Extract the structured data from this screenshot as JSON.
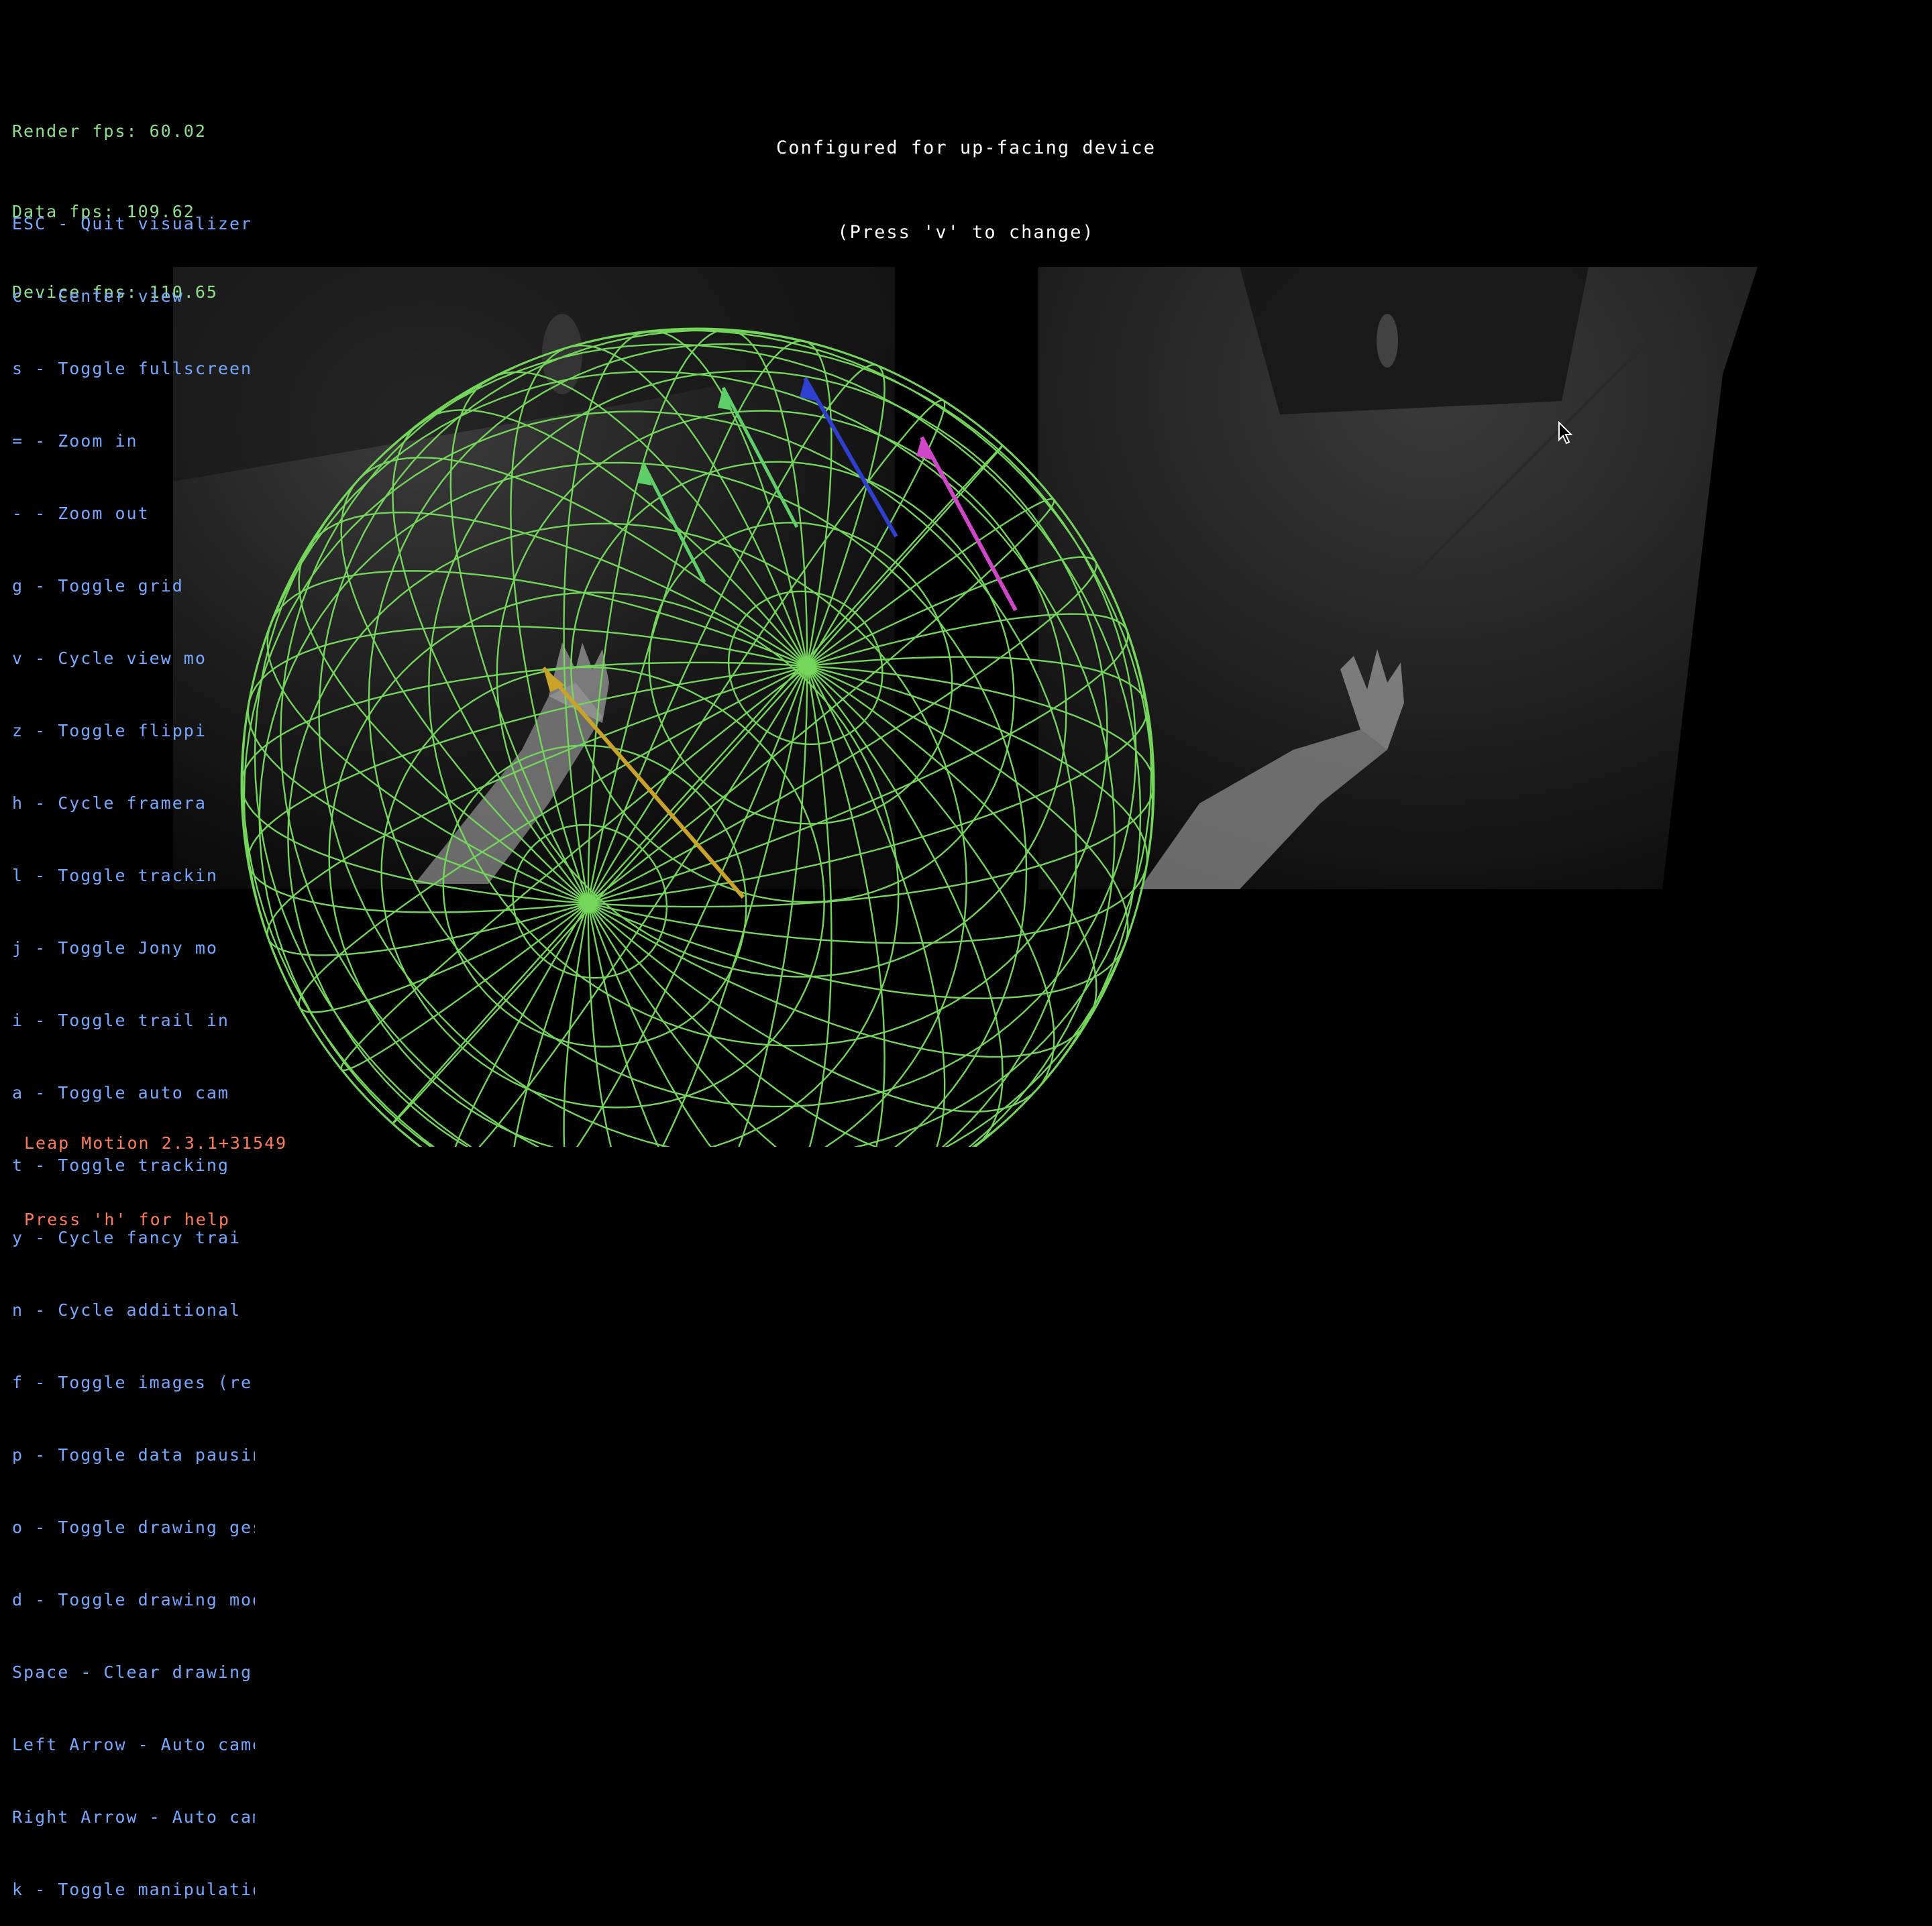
{
  "stats": {
    "render_fps": "Render fps: 60.02",
    "data_fps": "Data fps: 109.62",
    "device_fps": "Device fps: 110.65"
  },
  "shortcuts": [
    "ESC - Quit visualizer",
    "c - Center view",
    "s - Toggle fullscreen",
    "= - Zoom in",
    "- - Zoom out",
    "g - Toggle grid",
    "v - Cycle view mo",
    "z - Toggle flippi",
    "h - Cycle framera",
    "l - Toggle trackin",
    "j - Toggle Jony mo",
    "i - Toggle trail in",
    "a - Toggle auto cam",
    "t - Toggle tracking",
    "y - Cycle fancy trai",
    "n - Cycle additional",
    "f - Toggle images (re",
    "p - Toggle data pausin",
    "o - Toggle drawing ges",
    "d - Toggle drawing mode",
    "Space - Clear drawing",
    "Left Arrow - Auto camer",
    "Right Arrow - Auto came",
    "k - Toggle manipulatio"
  ],
  "config": {
    "line1": "Configured for up-facing device",
    "line2": "(Press 'v' to change)"
  },
  "version": {
    "line1": "Leap Motion 2.3.1+31549",
    "line2": "Press 'h' for help"
  },
  "colors": {
    "stats_text": "#8fe08a",
    "shortcut_text": "#76a8ff",
    "config_text": "#ffffff",
    "version_text": "#ff7a58",
    "sphere_wire": "#74d65a",
    "arrow_green": "#5fcf6a",
    "arrow_blue": "#2f3fd0",
    "arrow_magenta": "#d046c8",
    "arrow_yellow": "#c9a22a"
  },
  "icons": {
    "cursor": "mouse-pointer-icon",
    "sphere": "wireframe-sphere-icon"
  }
}
